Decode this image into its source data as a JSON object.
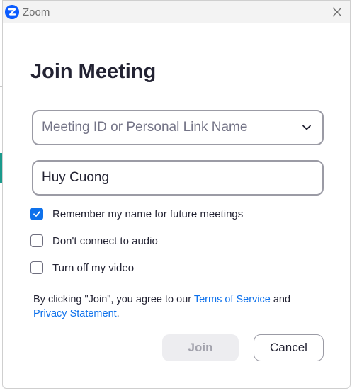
{
  "window": {
    "title": "Zoom",
    "logo_letter": "Z",
    "close_glyph": "✕",
    "brand_color": "#0b5cff"
  },
  "dialog": {
    "heading": "Join Meeting",
    "meeting_id": {
      "value": "",
      "placeholder": "Meeting ID or Personal Link Name"
    },
    "name": {
      "value": "Huy Cuong",
      "placeholder": ""
    },
    "options": [
      {
        "label": "Remember my name for future meetings",
        "checked": true
      },
      {
        "label": "Don't connect to audio",
        "checked": false
      },
      {
        "label": "Turn off my video",
        "checked": false
      }
    ],
    "legal": {
      "prefix": "By clicking \"Join\", you agree to our ",
      "terms_link": "Terms of Service",
      "middle": " and ",
      "privacy_link": "Privacy Statement",
      "suffix": "."
    },
    "buttons": {
      "join": "Join",
      "cancel": "Cancel"
    },
    "accent_color": "#0e71eb"
  }
}
